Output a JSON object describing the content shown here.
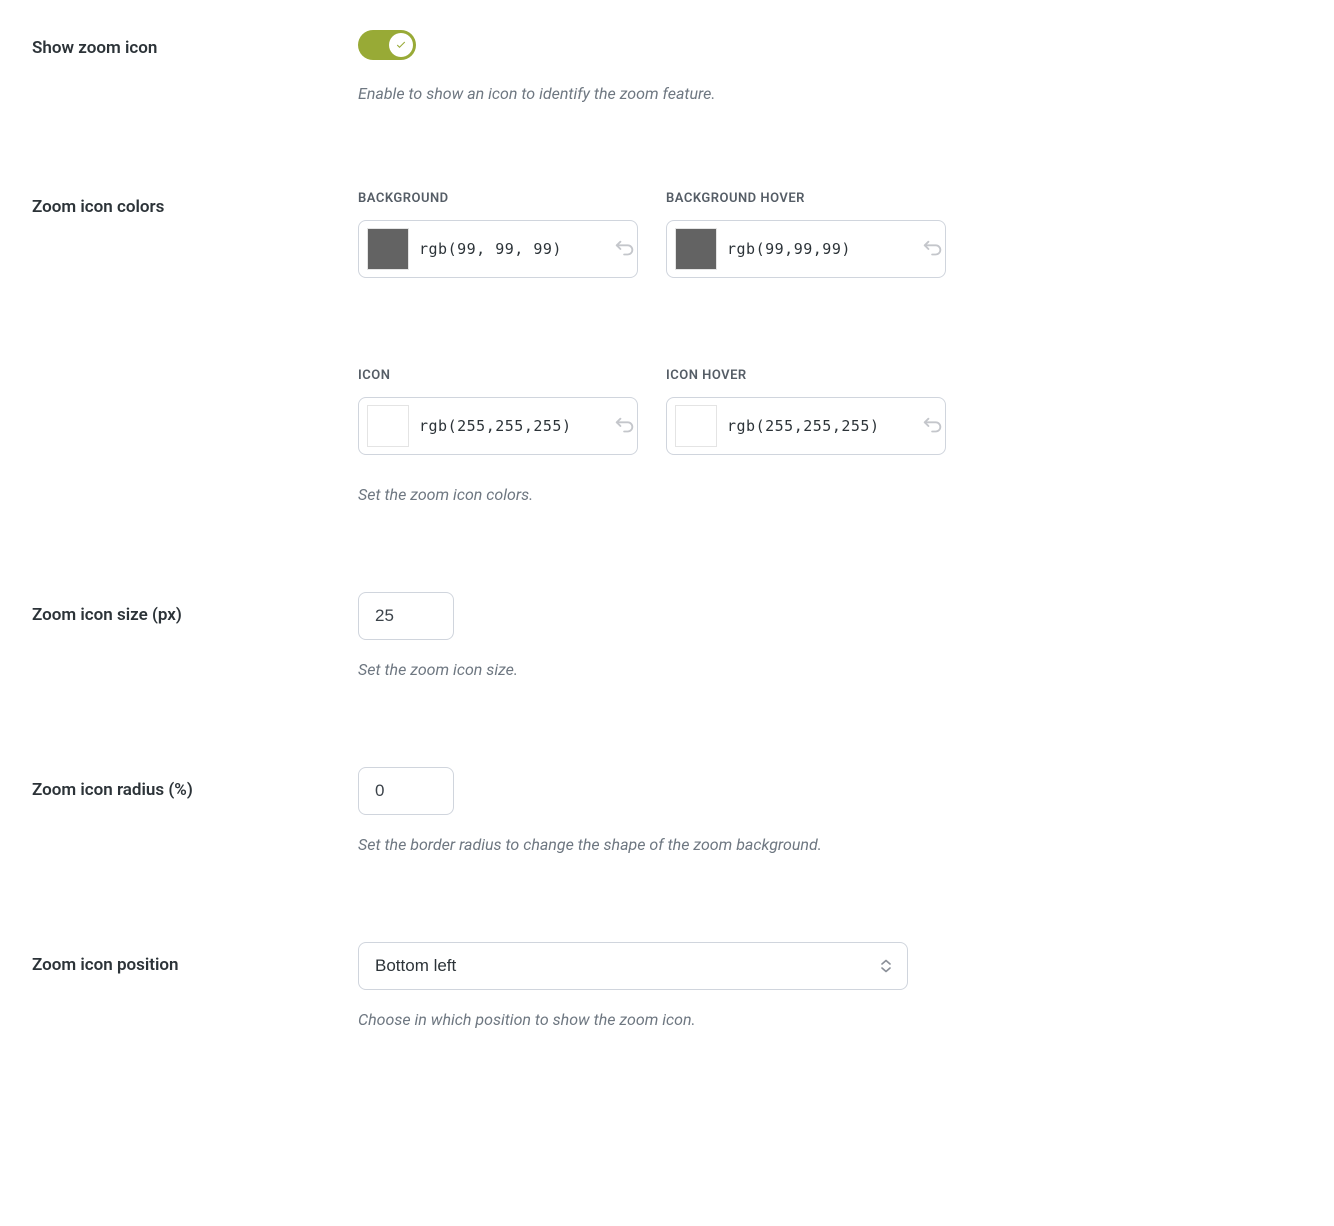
{
  "show_zoom_icon": {
    "label": "Show zoom icon",
    "enabled": true,
    "description": "Enable to show an icon to identify the zoom feature."
  },
  "zoom_icon_colors": {
    "label": "Zoom icon colors",
    "description": "Set the zoom icon colors.",
    "background": {
      "label": "BACKGROUND",
      "value": "rgb(99, 99, 99)",
      "swatch": "#636363"
    },
    "background_hover": {
      "label": "BACKGROUND HOVER",
      "value": "rgb(99,99,99)",
      "swatch": "#636363"
    },
    "icon": {
      "label": "ICON",
      "value": "rgb(255,255,255)",
      "swatch": "#ffffff"
    },
    "icon_hover": {
      "label": "ICON HOVER",
      "value": "rgb(255,255,255)",
      "swatch": "#ffffff"
    }
  },
  "zoom_icon_size": {
    "label": "Zoom icon size (px)",
    "value": "25",
    "description": "Set the zoom icon size."
  },
  "zoom_icon_radius": {
    "label": "Zoom icon radius (%)",
    "value": "0",
    "description": "Set the border radius to change the shape of the zoom background."
  },
  "zoom_icon_position": {
    "label": "Zoom icon position",
    "value": "Bottom left",
    "description": "Choose in which position to show the zoom icon."
  }
}
